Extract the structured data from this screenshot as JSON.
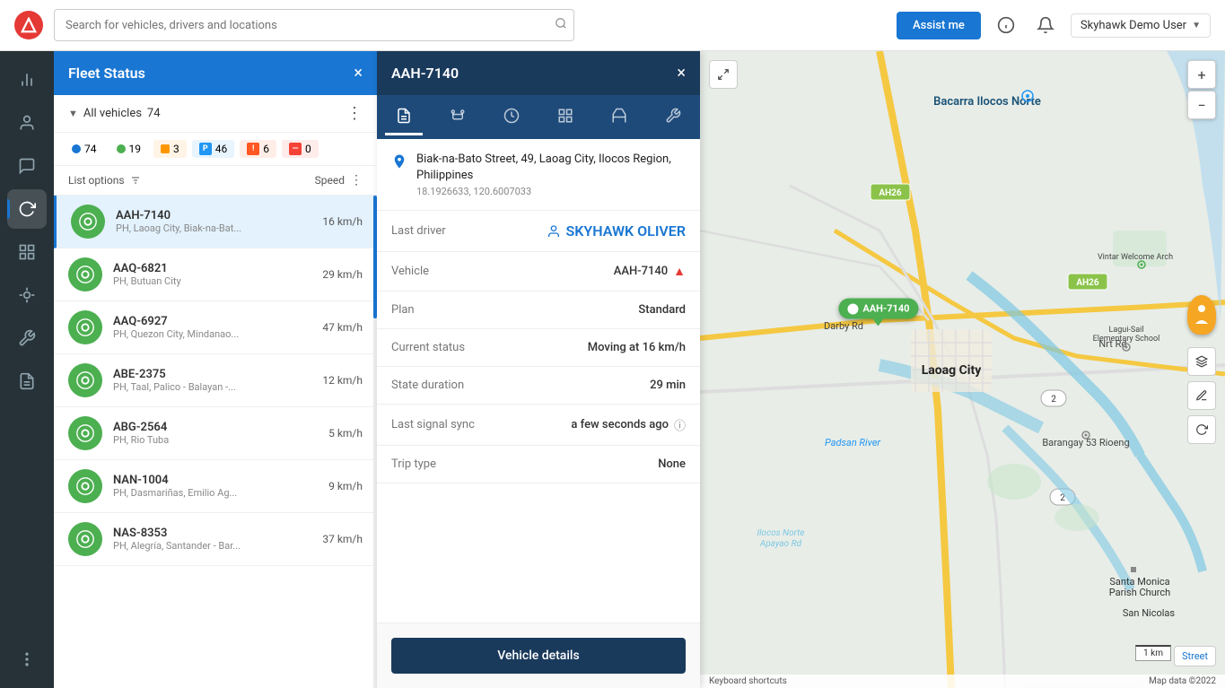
{
  "topbar": {
    "search_placeholder": "Search for vehicles, drivers and locations",
    "assist_label": "Assist me",
    "user_name": "Skyhawk Demo User"
  },
  "fleet_panel": {
    "title": "Fleet Status",
    "close_label": "×",
    "all_vehicles_label": "All vehicles",
    "all_vehicles_count": "74",
    "list_options_label": "List options",
    "speed_label": "Speed",
    "status_filters": [
      {
        "count": "74",
        "type": "blue"
      },
      {
        "count": "19",
        "type": "green"
      },
      {
        "count": "3",
        "type": "orange"
      },
      {
        "count": "46",
        "type": "parking"
      },
      {
        "count": "6",
        "type": "alert"
      },
      {
        "count": "0",
        "type": "red"
      }
    ],
    "vehicles": [
      {
        "id": "AAH-7140",
        "location": "PH, Laoag City, Biak-na-Bat...",
        "speed": "16 km/h",
        "active": true
      },
      {
        "id": "AAQ-6821",
        "location": "PH, Butuan City",
        "speed": "29 km/h",
        "active": false
      },
      {
        "id": "AAQ-6927",
        "location": "PH, Quezon City, Mindanao...",
        "speed": "47 km/h",
        "active": false
      },
      {
        "id": "ABE-2375",
        "location": "PH, Taal, Palico - Balayan -...",
        "speed": "12 km/h",
        "active": false
      },
      {
        "id": "ABG-2564",
        "location": "PH, Rio Tuba",
        "speed": "5 km/h",
        "active": false
      },
      {
        "id": "NAN-1004",
        "location": "PH, Dasmariñas, Emilio Ag...",
        "speed": "9 km/h",
        "active": false
      },
      {
        "id": "NAS-8353",
        "location": "PH, Alegría, Santander - Bar...",
        "speed": "37 km/h",
        "active": false
      }
    ]
  },
  "detail_panel": {
    "vehicle_id": "AAH-7140",
    "close_label": "×",
    "tabs": [
      {
        "id": "info",
        "icon": "📄",
        "active": true
      },
      {
        "id": "route",
        "icon": "🔀"
      },
      {
        "id": "history",
        "icon": "🕐"
      },
      {
        "id": "geofence",
        "icon": "📋"
      },
      {
        "id": "fuel",
        "icon": "⛽"
      },
      {
        "id": "tools",
        "icon": "🔧"
      }
    ],
    "location": {
      "address": "Biak-na-Bato Street, 49, Laoag City, Ilocos Region, Philippines",
      "coords": "18.1926633, 120.6007033"
    },
    "fields": [
      {
        "label": "Last driver",
        "value": "SKYHAWK OLIVER",
        "type": "driver"
      },
      {
        "label": "Vehicle",
        "value": "AAH-7140",
        "type": "vehicle"
      },
      {
        "label": "Plan",
        "value": "Standard",
        "type": "text"
      },
      {
        "label": "Current status",
        "value": "Moving at 16 km/h",
        "type": "text"
      },
      {
        "label": "State duration",
        "value": "29 min",
        "type": "text"
      },
      {
        "label": "Last signal sync",
        "value": "a few seconds ago",
        "type": "info"
      },
      {
        "label": "Trip type",
        "value": "None",
        "type": "text"
      }
    ],
    "footer_btn": "Vehicle details"
  },
  "map": {
    "vehicle_marker_label": "AAH-7140",
    "copyright": "Map data ©2022",
    "keyboard_label": "Keyboard shortcuts",
    "scale_label": "1 km",
    "street_label": "Street"
  },
  "sidebar": {
    "items": [
      {
        "id": "chart",
        "icon": "📊"
      },
      {
        "id": "user",
        "icon": "👤"
      },
      {
        "id": "message",
        "icon": "💬"
      },
      {
        "id": "refresh",
        "icon": "🔄"
      },
      {
        "id": "grid",
        "icon": "⊞"
      },
      {
        "id": "route",
        "icon": "⬡"
      },
      {
        "id": "tools",
        "icon": "⚙"
      },
      {
        "id": "report",
        "icon": "📋"
      },
      {
        "id": "settings",
        "icon": "⚙"
      },
      {
        "id": "more",
        "icon": "•••"
      }
    ]
  }
}
